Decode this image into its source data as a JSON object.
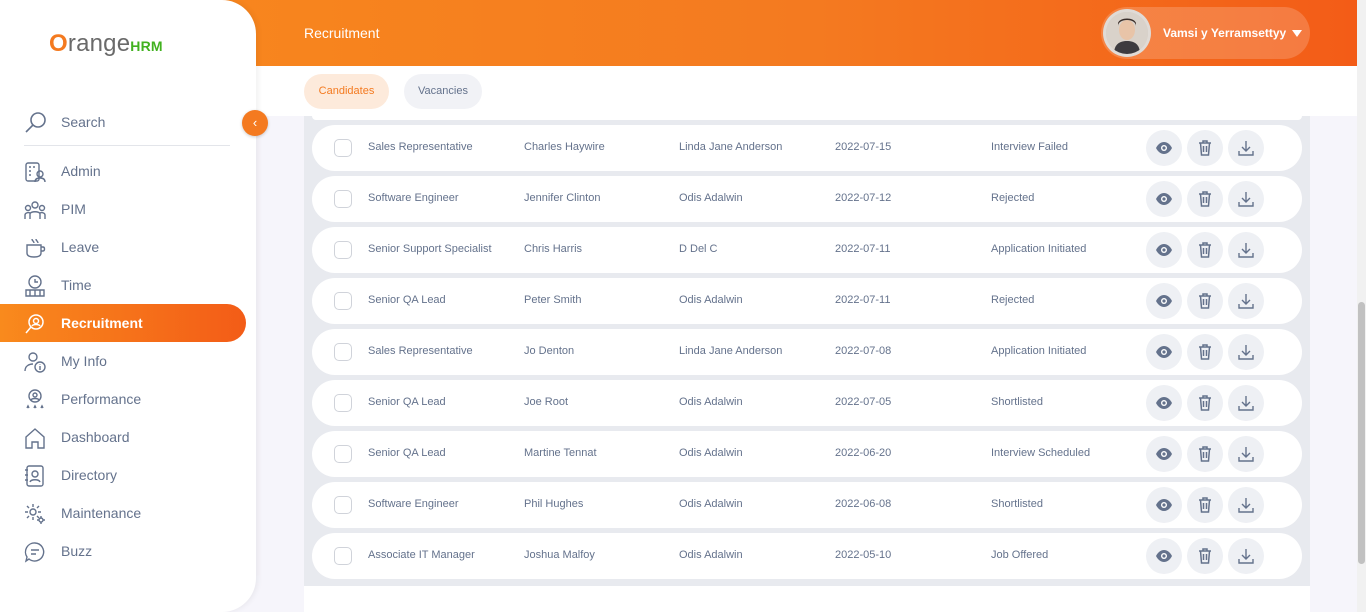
{
  "header": {
    "title": "Recruitment",
    "user_name": "Vamsi y Yerramsettyy"
  },
  "brand": {
    "logo_o": "O",
    "logo_range": "range",
    "logo_hrm": "HRM",
    "accent_color": "#f47a20",
    "logo_green": "#41b11f"
  },
  "tabs": [
    {
      "label": "Candidates",
      "active": true
    },
    {
      "label": "Vacancies",
      "active": false
    }
  ],
  "sidebar": {
    "search_label": "Search",
    "items": [
      {
        "label": "Admin",
        "icon": "admin-icon"
      },
      {
        "label": "PIM",
        "icon": "pim-icon"
      },
      {
        "label": "Leave",
        "icon": "leave-icon"
      },
      {
        "label": "Time",
        "icon": "time-icon"
      },
      {
        "label": "Recruitment",
        "icon": "recruitment-icon",
        "active": true
      },
      {
        "label": "My Info",
        "icon": "my-info-icon"
      },
      {
        "label": "Performance",
        "icon": "performance-icon"
      },
      {
        "label": "Dashboard",
        "icon": "dashboard-icon"
      },
      {
        "label": "Directory",
        "icon": "directory-icon"
      },
      {
        "label": "Maintenance",
        "icon": "maintenance-icon"
      },
      {
        "label": "Buzz",
        "icon": "buzz-icon"
      }
    ]
  },
  "candidates": {
    "rows": [
      {
        "vacancy": "Sales Representative",
        "candidate": "Charles Haywire",
        "hiring_manager": "Linda Jane Anderson",
        "date": "2022-07-15",
        "status": "Interview Failed"
      },
      {
        "vacancy": "Software Engineer",
        "candidate": "Jennifer Clinton",
        "hiring_manager": "Odis Adalwin",
        "date": "2022-07-12",
        "status": "Rejected"
      },
      {
        "vacancy": "Senior Support Specialist",
        "candidate": "Chris Harris",
        "hiring_manager": "D Del C",
        "date": "2022-07-11",
        "status": "Application Initiated"
      },
      {
        "vacancy": "Senior QA Lead",
        "candidate": "Peter Smith",
        "hiring_manager": "Odis Adalwin",
        "date": "2022-07-11",
        "status": "Rejected"
      },
      {
        "vacancy": "Sales Representative",
        "candidate": "Jo Denton",
        "hiring_manager": "Linda Jane Anderson",
        "date": "2022-07-08",
        "status": "Application Initiated"
      },
      {
        "vacancy": "Senior QA Lead",
        "candidate": "Joe Root",
        "hiring_manager": "Odis Adalwin",
        "date": "2022-07-05",
        "status": "Shortlisted"
      },
      {
        "vacancy": "Senior QA Lead",
        "candidate": "Martine Tennat",
        "hiring_manager": "Odis Adalwin",
        "date": "2022-06-20",
        "status": "Interview Scheduled"
      },
      {
        "vacancy": "Software Engineer",
        "candidate": "Phil Hughes",
        "hiring_manager": "Odis Adalwin",
        "date": "2022-06-08",
        "status": "Shortlisted"
      },
      {
        "vacancy": "Associate IT Manager",
        "candidate": "Joshua Malfoy",
        "hiring_manager": "Odis Adalwin",
        "date": "2022-05-10",
        "status": "Job Offered"
      }
    ]
  }
}
